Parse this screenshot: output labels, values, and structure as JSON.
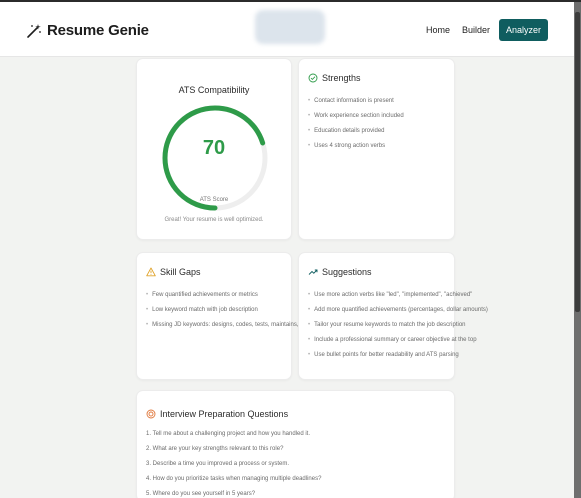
{
  "navbar": {
    "brand": "Resume Genie",
    "links": [
      "Home",
      "Builder"
    ],
    "active_link": "Analyzer"
  },
  "ats": {
    "title": "ATS Compatibility",
    "score": 70,
    "score_fraction": 0.7,
    "score_label": "ATS Score",
    "message": "Great! Your resume is well optimized.",
    "accent": "#2e9b49"
  },
  "strengths": {
    "title": "Strengths",
    "items": [
      "Contact information is present",
      "Work experience section included",
      "Education details provided",
      "Uses 4 strong action verbs"
    ]
  },
  "skill_gaps": {
    "title": "Skill Gaps",
    "items": [
      "Few quantified achievements or metrics",
      "Low keyword match with job description",
      "Missing JD keywords: designs, codes, tests, maintains, applications."
    ]
  },
  "suggestions": {
    "title": "Suggestions",
    "items": [
      "Use more action verbs like \"led\", \"implemented\", \"achieved\"",
      "Add more quantified achievements (percentages, dollar amounts)",
      "Tailor your resume keywords to match the job description",
      "Include a professional summary or career objective at the top",
      "Use bullet points for better readability and ATS parsing"
    ]
  },
  "interview": {
    "title": "Interview Preparation Questions",
    "items": [
      "1.  Tell me about a challenging project and how you handled it.",
      "2.  What are your key strengths relevant to this role?",
      "3.  Describe a time you improved a process or system.",
      "4.  How do you prioritize tasks when managing multiple deadlines?",
      "5.  Where do you see yourself in 5 years?"
    ]
  },
  "icons": {
    "brand": "magic-wand-icon",
    "strengths": "check-circle-icon",
    "skill_gaps": "warning-triangle-icon",
    "suggestions": "trending-up-icon",
    "interview": "target-icon"
  },
  "colors": {
    "primary": "#0f5d5f",
    "success": "#2e9b49",
    "warning": "#e0a32b",
    "interview": "#e0773b"
  }
}
